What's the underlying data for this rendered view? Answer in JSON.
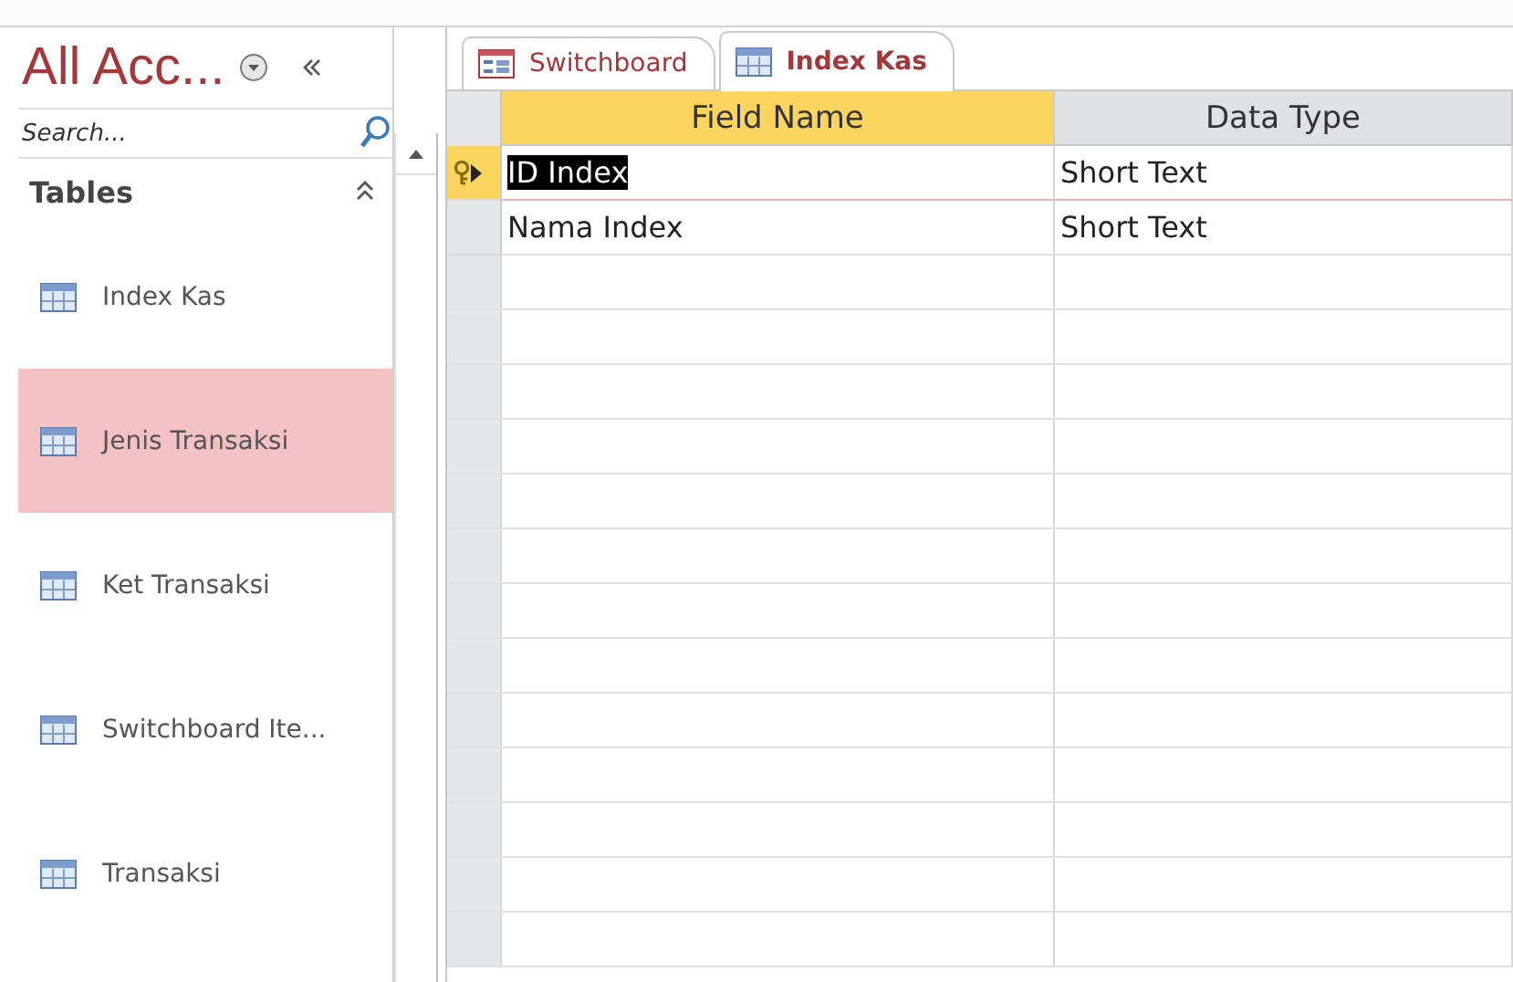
{
  "nav": {
    "title": "All Acc...",
    "search": {
      "placeholder": "Search..."
    },
    "group": {
      "label": "Tables",
      "expanded": true
    },
    "items": [
      {
        "label": "Index Kas",
        "selected": false
      },
      {
        "label": "Jenis Transaksi",
        "selected": true
      },
      {
        "label": "Ket Transaksi",
        "selected": false
      },
      {
        "label": "Switchboard Ite...",
        "selected": false
      },
      {
        "label": "Transaksi",
        "selected": false
      }
    ]
  },
  "tabs": [
    {
      "label": "Switchboard",
      "kind": "form",
      "selected": false
    },
    {
      "label": "Index Kas",
      "kind": "table",
      "selected": true
    }
  ],
  "table": {
    "columns": [
      "Field Name",
      "Data Type"
    ],
    "rows": [
      {
        "cells": [
          "ID Index",
          "Short Text"
        ],
        "selected": true,
        "primary_key": true
      },
      {
        "cells": [
          "Nama Index",
          "Short Text"
        ],
        "selected": false,
        "primary_key": false
      }
    ]
  }
}
